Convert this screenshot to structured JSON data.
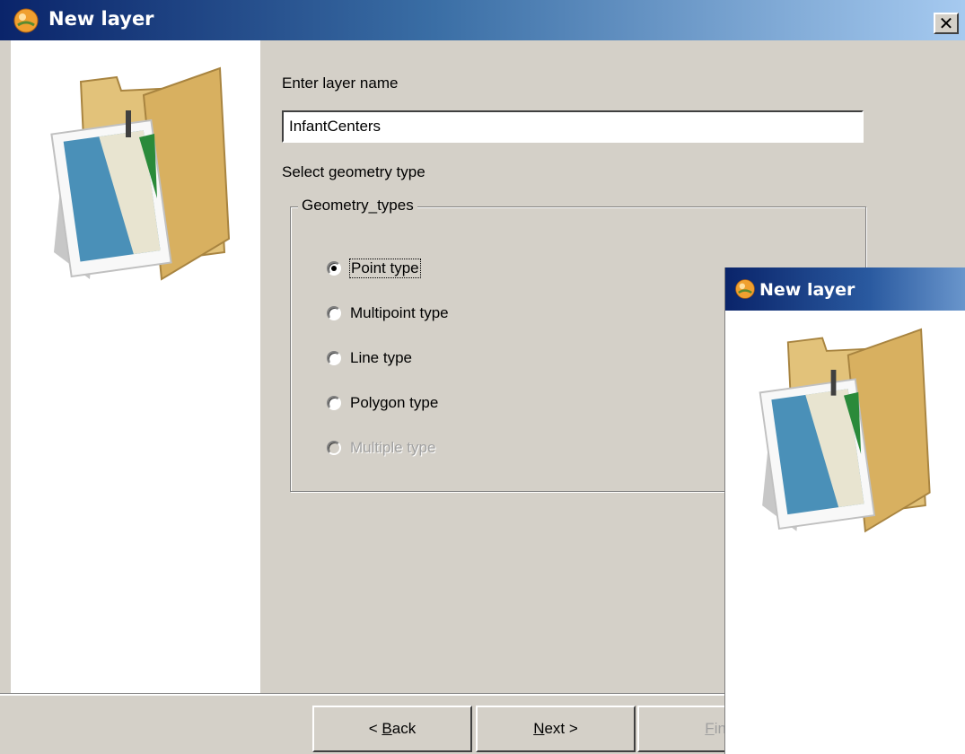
{
  "window": {
    "title": "New layer",
    "app_icon": "gvsig-app-icon",
    "close_label": "✕"
  },
  "side_image": "folder-with-map-icon",
  "form": {
    "layer_name_label": "Enter layer name",
    "layer_name_value": "InfantCenters",
    "geometry_label": "Select geometry type",
    "group_title": "Geometry_types",
    "options": [
      {
        "label": "Point type",
        "selected": true,
        "enabled": true
      },
      {
        "label": "Multipoint type",
        "selected": false,
        "enabled": true
      },
      {
        "label": "Line type",
        "selected": false,
        "enabled": true
      },
      {
        "label": "Polygon type",
        "selected": false,
        "enabled": true
      },
      {
        "label": "Multiple type",
        "selected": false,
        "enabled": false
      }
    ]
  },
  "buttons": {
    "back": {
      "prefix": "< ",
      "mnemonic": "B",
      "rest": "ack"
    },
    "next": {
      "mnemonic": "N",
      "rest": "ext >"
    },
    "finish": {
      "mnemonic": "F",
      "rest": "ini"
    }
  },
  "overlay_window": {
    "title": "New layer"
  }
}
